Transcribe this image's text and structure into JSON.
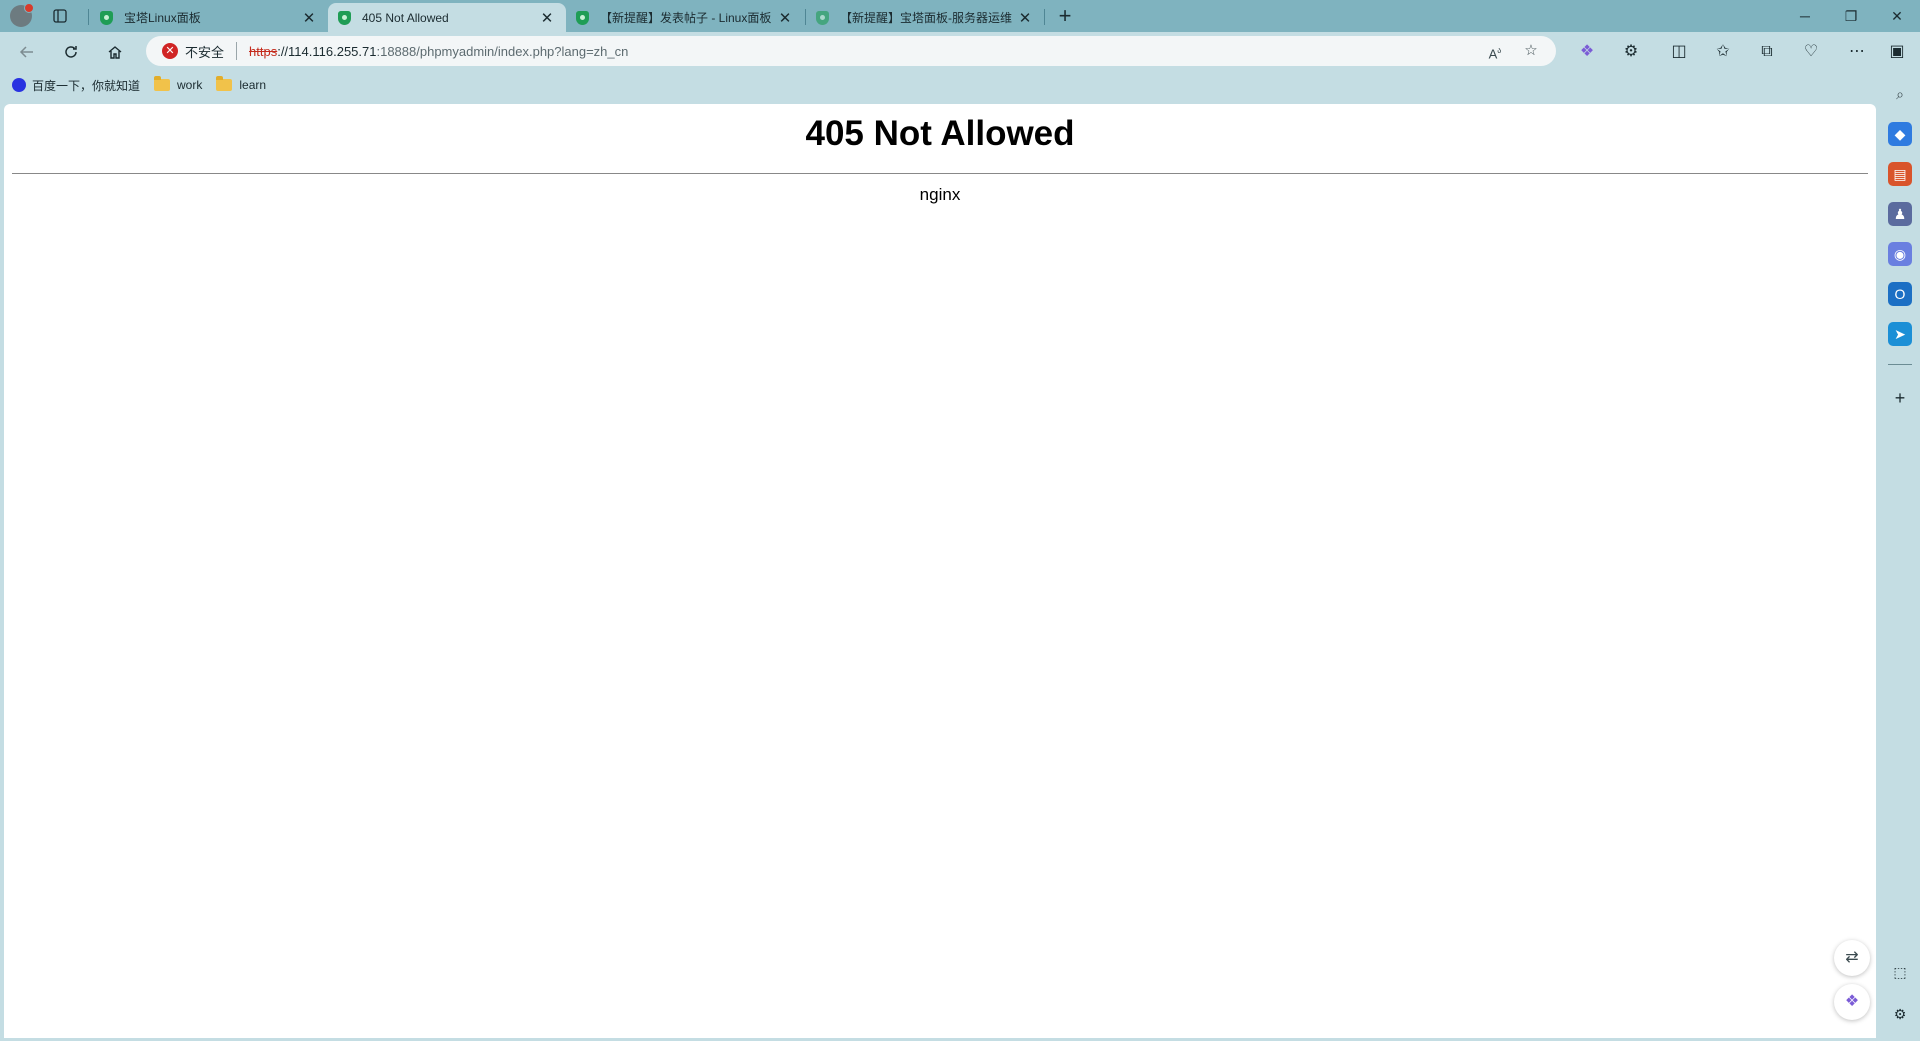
{
  "browser": {
    "tabs": [
      {
        "title": "宝塔Linux面板",
        "active": false
      },
      {
        "title": "405 Not Allowed",
        "active": true
      },
      {
        "title": "【新提醒】发表帖子 - Linux面板",
        "active": false
      },
      {
        "title": "【新提醒】宝塔面板-服务器运维",
        "active": false
      }
    ],
    "new_tab_label": "+",
    "window_controls": {
      "minimize": "─",
      "restore": "❐",
      "close": "✕"
    },
    "security_label": "不安全",
    "url": {
      "scheme": "https",
      "host": "://114.116.255.71",
      "path": ":18888/phpmyadmin/index.php?lang=zh_cn"
    },
    "favorites": [
      {
        "label": "百度一下，你就知道",
        "icon": "baidu-icon"
      },
      {
        "label": "work",
        "icon": "folder-icon"
      },
      {
        "label": "learn",
        "icon": "folder-icon"
      }
    ],
    "accent_color": "#7fb3bf",
    "insecure_color": "#c42b1c"
  },
  "page": {
    "heading": "405 Not Allowed",
    "server": "nginx"
  }
}
